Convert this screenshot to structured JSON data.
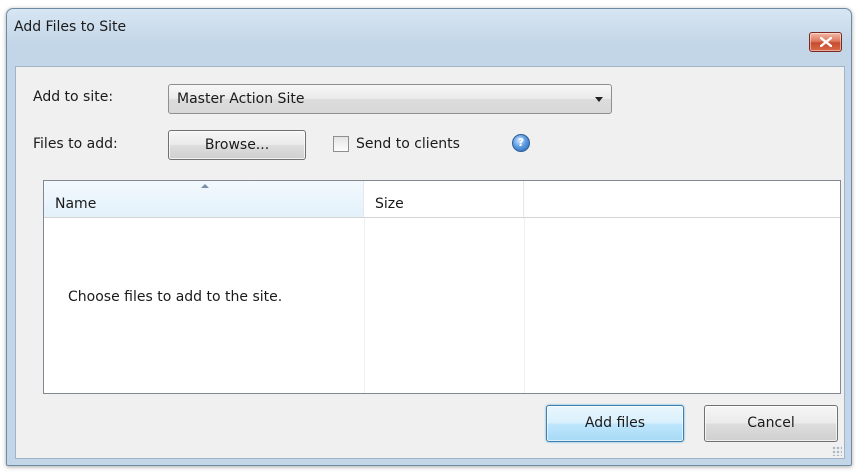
{
  "window": {
    "title": "Add Files to Site",
    "close_icon": "close-icon"
  },
  "form": {
    "add_to_site_label": "Add to site:",
    "site_selected": "Master Action Site",
    "files_to_add_label": "Files to add:",
    "browse_label": "Browse...",
    "send_to_clients_label": "Send to clients",
    "send_to_clients_checked": false,
    "help_icon": "help-icon"
  },
  "file_list": {
    "columns": [
      "Name",
      "Size"
    ],
    "sort_column": "Name",
    "empty_message": "Choose files to add to the site."
  },
  "actions": {
    "add_files_label": "Add files",
    "cancel_label": "Cancel"
  },
  "colors": {
    "window_frame": "#c3d6e8",
    "close_button": "#c74c2f",
    "default_button_border": "#3c7fb1"
  }
}
